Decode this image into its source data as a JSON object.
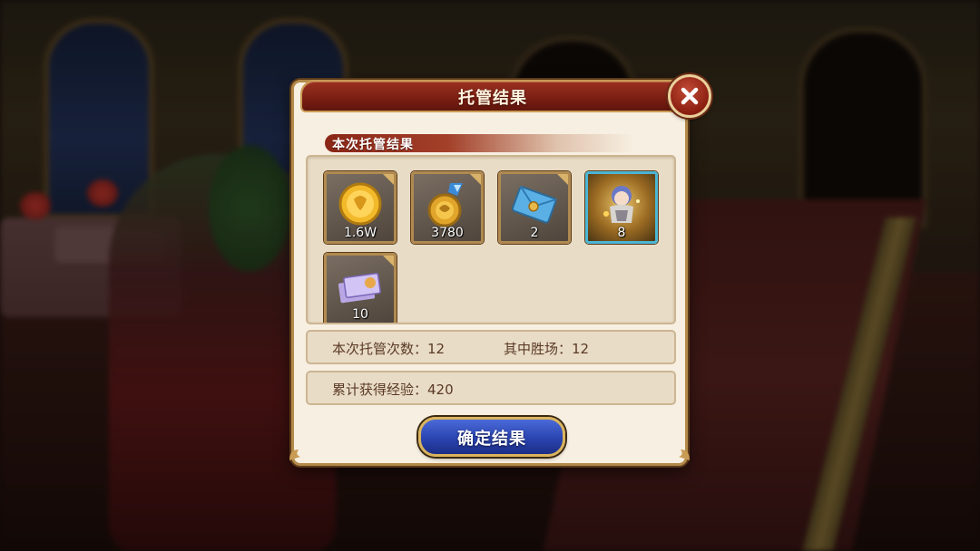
{
  "dialog": {
    "title": "托管结果",
    "section_title": "本次托管结果",
    "rewards": [
      {
        "name": "gold-coin",
        "qty": "1.6W"
      },
      {
        "name": "medal",
        "qty": "3780"
      },
      {
        "name": "blue-envelope",
        "qty": "2"
      },
      {
        "name": "character-card",
        "qty": "8"
      },
      {
        "name": "ticket-cards",
        "qty": "10"
      }
    ],
    "stats": {
      "runs_label": "本次托管次数：12",
      "wins_label": "其中胜场：12",
      "exp_label": "累计获得经验：420"
    },
    "confirm_label": "确定结果"
  },
  "colors": {
    "title_bar": "#7a1e12",
    "panel_bg": "#f7efe1",
    "confirm_button": "#2a44b0",
    "frame_gold": "#b48a4a"
  },
  "icons": [
    "close-icon",
    "gold-coin-icon",
    "medal-icon",
    "envelope-icon",
    "character-icon",
    "ticket-icon"
  ]
}
